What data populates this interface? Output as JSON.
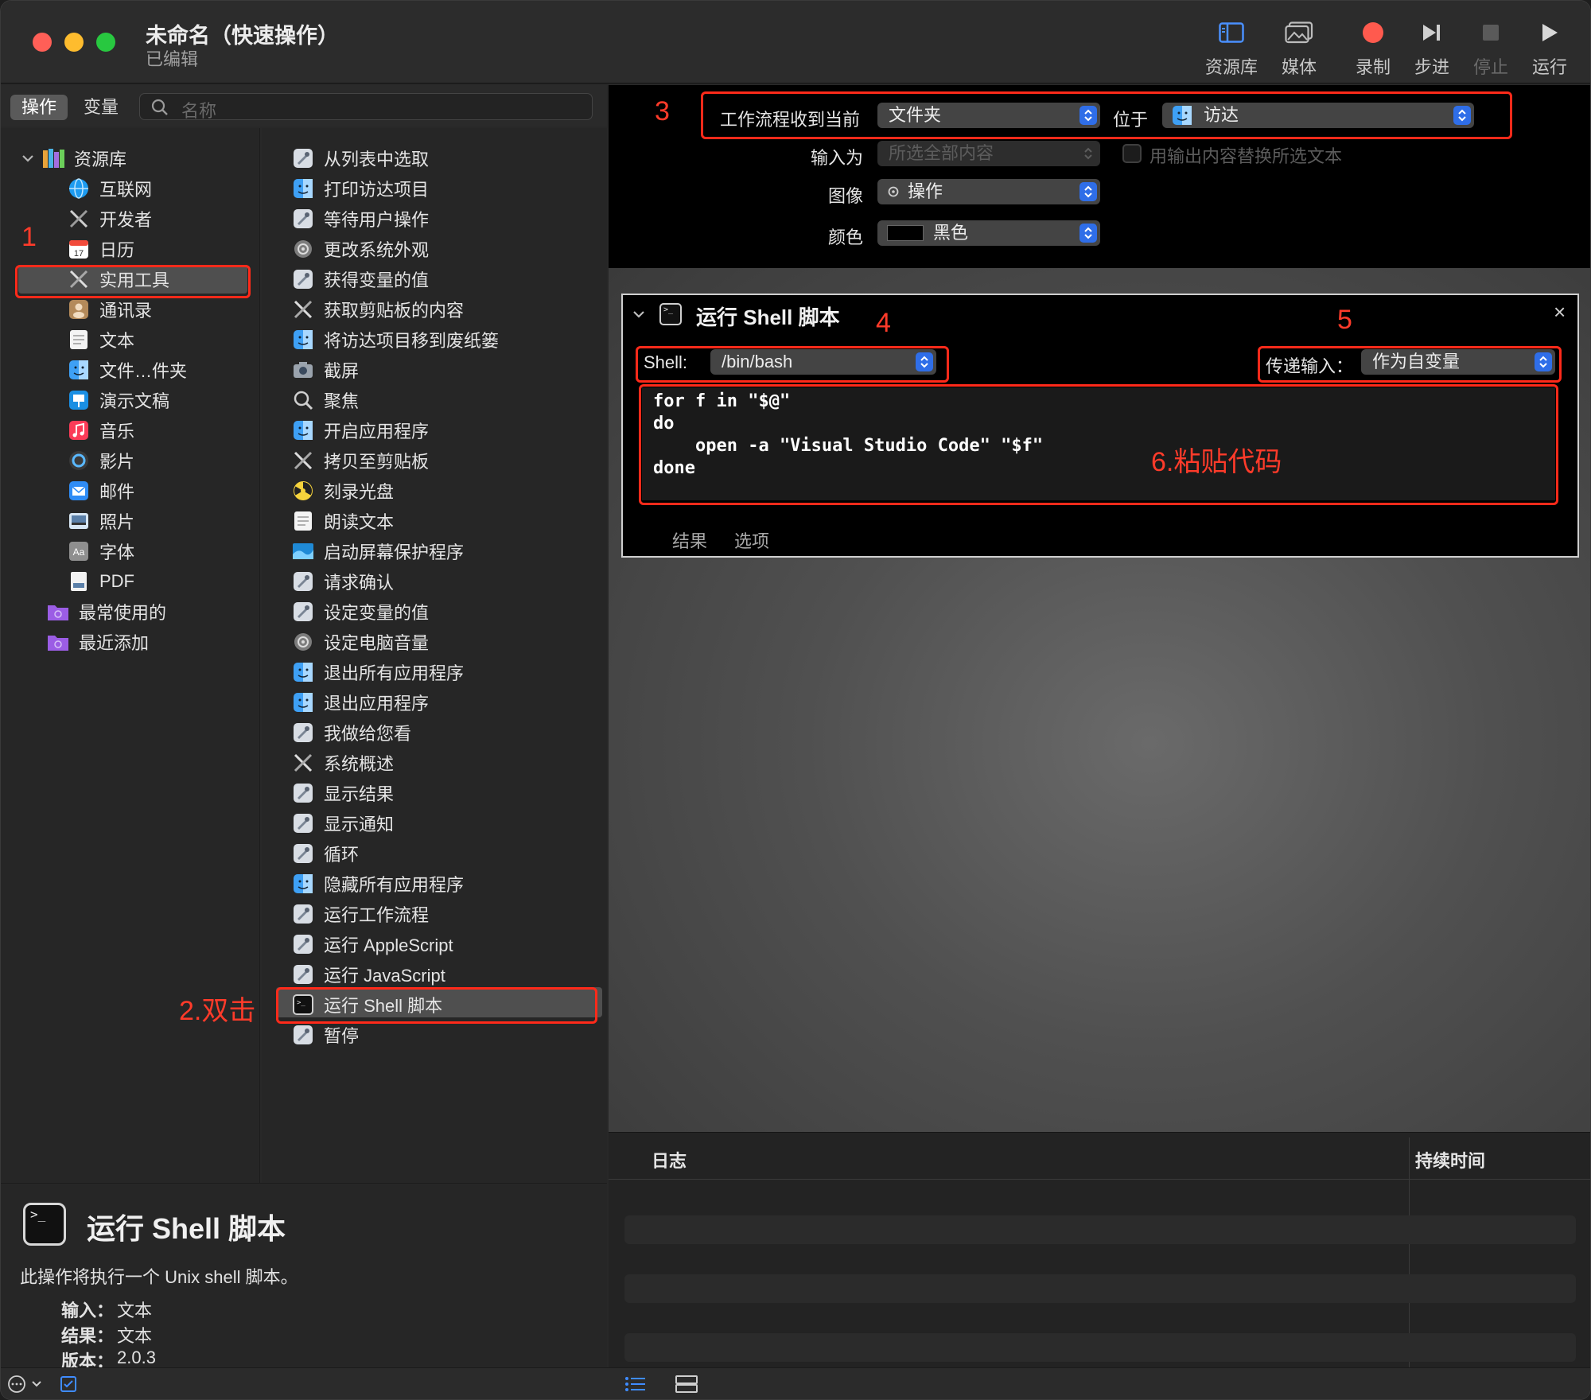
{
  "window": {
    "title": "未命名（快速操作）",
    "subtitle": "已编辑"
  },
  "toolbar": {
    "library": "资源库",
    "media": "媒体",
    "record": "录制",
    "step": "步进",
    "stop": "停止",
    "run": "运行"
  },
  "left_tabs": {
    "actions": "操作",
    "variables": "变量",
    "search_placeholder": "名称"
  },
  "library": {
    "root": "资源库",
    "items": [
      "互联网",
      "开发者",
      "日历",
      "实用工具",
      "通讯录",
      "文本",
      "文件…件夹",
      "演示文稿",
      "音乐",
      "影片",
      "邮件",
      "照片",
      "字体",
      "PDF"
    ],
    "most_used": "最常使用的",
    "recent": "最近添加"
  },
  "actions": [
    "从列表中选取",
    "打印访达项目",
    "等待用户操作",
    "更改系统外观",
    "获得变量的值",
    "获取剪贴板的内容",
    "将访达项目移到废纸篓",
    "截屏",
    "聚焦",
    "开启应用程序",
    "拷贝至剪贴板",
    "刻录光盘",
    "朗读文本",
    "启动屏幕保护程序",
    "请求确认",
    "设定变量的值",
    "设定电脑音量",
    "退出所有应用程序",
    "退出应用程序",
    "我做给您看",
    "系统概述",
    "显示结果",
    "显示通知",
    "循环",
    "隐藏所有应用程序",
    "运行工作流程",
    "运行 AppleScript",
    "运行 JavaScript",
    "运行 Shell 脚本",
    "暂停"
  ],
  "description": {
    "title": "运行 Shell 脚本",
    "text": "此操作将执行一个 Unix shell 脚本。",
    "input_label": "输入：",
    "input_value": "文本",
    "result_label": "结果：",
    "result_value": "文本",
    "version_label": "版本：",
    "version_value": "2.0.3"
  },
  "workflow": {
    "receives_label": "工作流程收到当前",
    "receives_value": "文件夹",
    "in_label": "位于",
    "in_value": "访达",
    "input_is_label": "输入为",
    "input_is_value": "所选全部内容",
    "replace_label": "用输出内容替换所选文本",
    "image_label": "图像",
    "image_value": "操作",
    "color_label": "颜色",
    "color_value": "黑色"
  },
  "action_card": {
    "title": "运行 Shell 脚本",
    "shell_label": "Shell:",
    "shell_value": "/bin/bash",
    "pass_input_label": "传递输入：",
    "pass_input_value": "作为自变量",
    "code_line1": "for f in \"$@\"",
    "code_line2": "do",
    "code_line3": "    open -a \"Visual Studio Code\" \"$f\"",
    "code_line4": "done",
    "tab_results": "结果",
    "tab_options": "选项"
  },
  "log": {
    "col_log": "日志",
    "col_duration": "持续时间"
  },
  "annotations": {
    "n1": "1",
    "n2": "2.双击",
    "n3": "3",
    "n4": "4",
    "n5": "5",
    "n6": "6.粘贴代码"
  },
  "colors": {
    "annotation_red": "#ff2a1a",
    "accent_blue": "#2f6ee8",
    "record_red": "#ff5a4e"
  }
}
